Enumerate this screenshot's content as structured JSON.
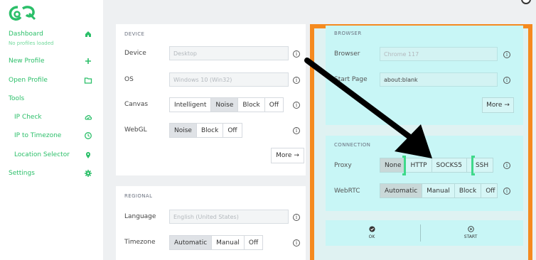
{
  "topbar": {
    "account_text": ""
  },
  "sidebar": {
    "items": [
      {
        "label": "Dashboard",
        "sub": "No profiles loaded",
        "icon": "home-icon"
      },
      {
        "label": "New Profile",
        "icon": "plus-icon"
      },
      {
        "label": "Open Profile",
        "icon": "folder-icon"
      },
      {
        "label": "Tools",
        "icon": ""
      },
      {
        "label": "IP Check",
        "icon": "cloud-check-icon"
      },
      {
        "label": "IP to Timezone",
        "icon": "clock-icon"
      },
      {
        "label": "Location Selector",
        "icon": "location-pin-icon"
      },
      {
        "label": "Settings",
        "icon": "gear-icon"
      }
    ]
  },
  "device": {
    "title": "DEVICE",
    "device_label": "Device",
    "device_value": "Desktop",
    "os_label": "OS",
    "os_value": "Windows 10 (Win32)",
    "canvas_label": "Canvas",
    "canvas_options": [
      "Intelligent",
      "Noise",
      "Block",
      "Off"
    ],
    "canvas_selected": "Noise",
    "webgl_label": "WebGL",
    "webgl_options": [
      "Noise",
      "Block",
      "Off"
    ],
    "webgl_selected": "Noise",
    "more": "More →"
  },
  "regional": {
    "title": "REGIONAL",
    "language_label": "Language",
    "language_value": "English (United States)",
    "timezone_label": "Timezone",
    "timezone_options": [
      "Automatic",
      "Manual",
      "Off"
    ],
    "timezone_selected": "Automatic"
  },
  "browser": {
    "title": "BROWSER",
    "browser_label": "Browser",
    "browser_value": "Chrome 117",
    "start_label": "Start Page",
    "start_value": "about:blank",
    "more": "More →"
  },
  "connection": {
    "title": "CONNECTION",
    "proxy_label": "Proxy",
    "proxy_options": [
      "None",
      "HTTP",
      "SOCKS5",
      "SSH"
    ],
    "proxy_selected": "None",
    "webrtc_label": "WebRTC",
    "webrtc_options": [
      "Automatic",
      "Manual",
      "Block",
      "Off"
    ],
    "webrtc_selected": "Automatic"
  },
  "footer": {
    "ok": "OK",
    "start": "START"
  },
  "colors": {
    "brand": "#2bbf69",
    "highlight_frame": "#f58a1f",
    "highlight_fill": "#c8f6f6",
    "annotation_arrow": "#000000",
    "bracket": "#3fd98a"
  }
}
